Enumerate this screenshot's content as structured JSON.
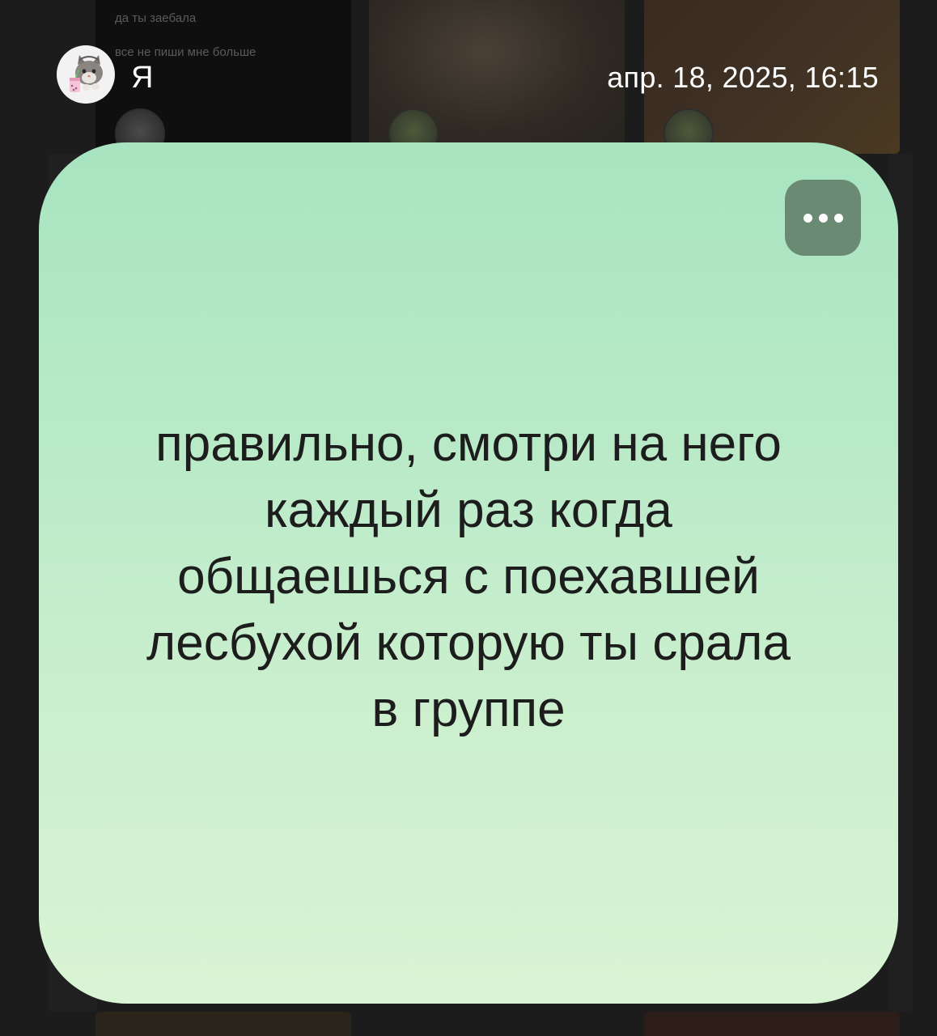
{
  "background": {
    "tile_texts": [
      "да ты заебала",
      "все не пиши мне больше"
    ]
  },
  "header": {
    "user_name": "Я",
    "datetime": "апр. 18, 2025, 16:15",
    "avatar_icon": "cat-avatar-icon"
  },
  "note": {
    "text": "правильно, смотри на него\nкаждый раз когда\nобщаешься с поехавшей\nлесбухой которую ты срала\nв группе",
    "more_icon": "more-horizontal-icon",
    "colors": {
      "card_top": "#a8e4c0",
      "card_bottom": "#d9f4d4",
      "more_button": "#6b8a73"
    }
  }
}
